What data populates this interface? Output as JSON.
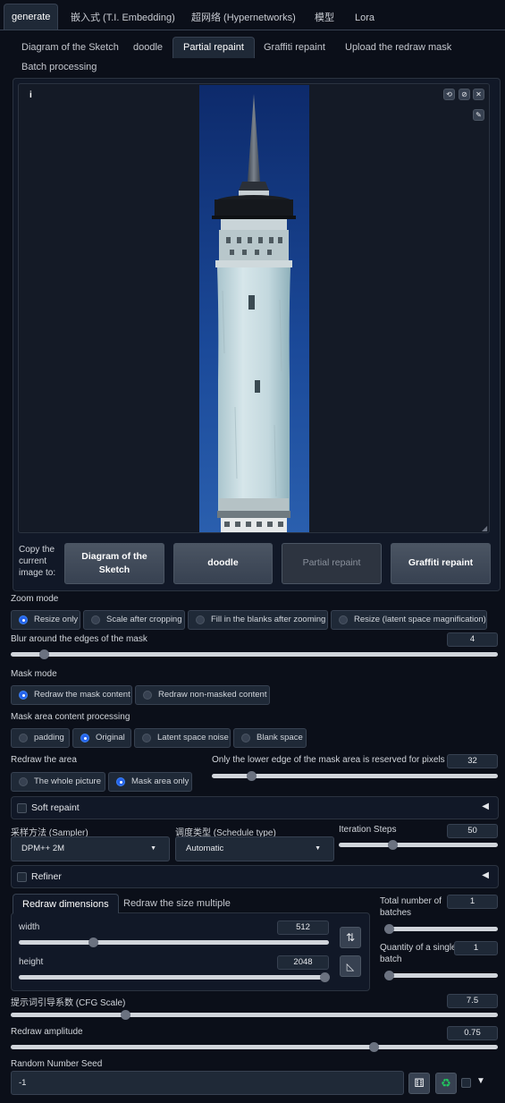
{
  "top_tabs": [
    "generate",
    "嵌入式 (T.I. Embedding)",
    "超网络 (Hypernetworks)",
    "模型",
    "Lora"
  ],
  "sub_tabs": [
    "Diagram of the Sketch",
    "doodle",
    "Partial repaint",
    "Graffiti repaint",
    "Upload the redraw mask",
    "Batch processing"
  ],
  "image_panel": {
    "info_icon": "i"
  },
  "copy": {
    "label_lines": [
      "Copy the",
      "current",
      "image to:"
    ],
    "buttons": [
      "Diagram of the Sketch",
      "doodle",
      "Partial repaint",
      "Graffiti repaint"
    ]
  },
  "zoom_mode": {
    "label": "Zoom mode",
    "options": [
      "Resize only",
      "Scale after cropping",
      "Fill in the blanks after zooming",
      "Resize (latent space magnification)"
    ],
    "selected": 0
  },
  "mask_blur": {
    "label": "Blur around the edges of the mask",
    "value": "4",
    "fraction": 0.06
  },
  "mask_mode": {
    "label": "Mask mode",
    "options": [
      "Redraw the mask content",
      "Redraw non-masked content"
    ],
    "selected": 0
  },
  "mask_content": {
    "label": "Mask area content processing",
    "options": [
      "padding",
      "Original",
      "Latent space noise",
      "Blank space"
    ],
    "selected": 1
  },
  "redraw_area": {
    "label": "Redraw the area",
    "options": [
      "The whole picture",
      "Mask area only"
    ],
    "selected": 1
  },
  "padding_pixels": {
    "label": "Only the lower edge of the mask area is reserved for pixels",
    "value": "32",
    "fraction": 0.125
  },
  "soft_repaint": {
    "label": "Soft repaint"
  },
  "sampler": {
    "label": "采样方法 (Sampler)",
    "value": "DPM++ 2M"
  },
  "schedule": {
    "label": "调度类型 (Schedule type)",
    "value": "Automatic"
  },
  "steps": {
    "label": "Iteration Steps",
    "value": "50",
    "fraction": 0.33
  },
  "refiner": {
    "label": "Refiner"
  },
  "dims_tabs": [
    "Redraw dimensions",
    "Redraw the size multiple"
  ],
  "width": {
    "label": "width",
    "value": "512",
    "fraction": 0.23
  },
  "height": {
    "label": "height",
    "value": "2048",
    "fraction": 1.0
  },
  "batch_count": {
    "label_lines": [
      "Total number of",
      "batches"
    ],
    "value": "1",
    "fraction": 0.0
  },
  "batch_size": {
    "label_lines": [
      "Quantity of a single",
      "batch"
    ],
    "value": "1",
    "fraction": 0.0
  },
  "cfg": {
    "label": "提示词引导系数 (CFG Scale)",
    "value": "7.5",
    "fraction": 0.23
  },
  "denoise": {
    "label": "Redraw amplitude",
    "value": "0.75",
    "fraction": 0.75
  },
  "seed": {
    "label": "Random Number Seed",
    "value": "-1"
  },
  "colors": {
    "accent": "#2563eb",
    "background": "#0b0f19",
    "panel": "#111827",
    "recycle_icon": "#22c55e"
  }
}
